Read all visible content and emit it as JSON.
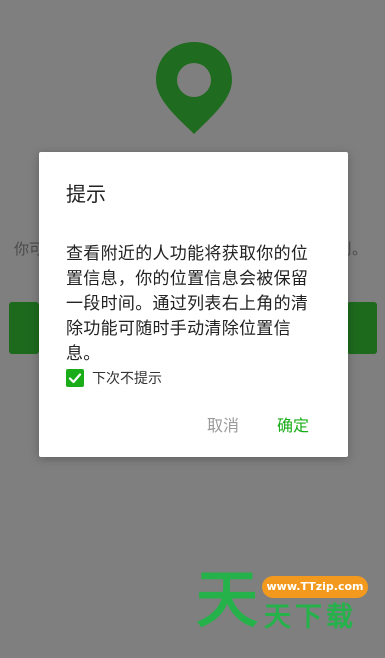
{
  "background": {
    "text_left": "你可",
    "text_right": "刂。"
  },
  "dialog": {
    "title": "提示",
    "message": "查看附近的人功能将获取你的位置信息，你的位置信息会被保留一段时间。通过列表右上角的清除功能可随时手动清除位置信息。",
    "checkbox_label": "下次不提示",
    "checkbox_checked": true,
    "cancel_label": "取消",
    "confirm_label": "确定"
  },
  "watermark": {
    "big_char": "天",
    "url": "www.TTzip.com",
    "text": "天下载"
  },
  "colors": {
    "accent": "#1aad19",
    "overlay": "#7f7f7f"
  }
}
